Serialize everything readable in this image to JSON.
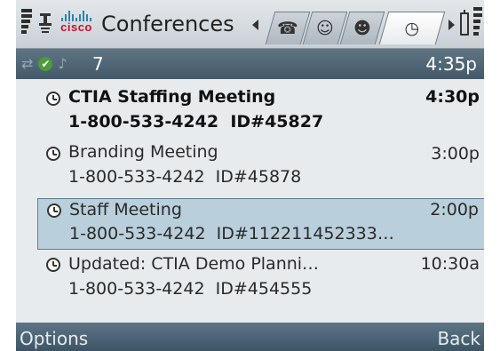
{
  "header": {
    "title": "Conferences",
    "logo_text": "cisco",
    "tabs": [
      {
        "icon": "phone-book-icon",
        "glyph": "☎"
      },
      {
        "icon": "meeting-icon",
        "glyph": "☺"
      },
      {
        "icon": "participants-icon",
        "glyph": "☻"
      },
      {
        "icon": "clock-icon",
        "glyph": "◷",
        "active": true
      }
    ]
  },
  "status": {
    "count": "7",
    "time": "4:35p"
  },
  "conferences": [
    {
      "title": "CTIA Staffing Meeting",
      "phone": "1-800-533-4242",
      "id": "ID#45827",
      "time": "4:30p"
    },
    {
      "title": "Branding Meeting",
      "phone": "1-800-533-4242",
      "id": "ID#45878",
      "time": "3:00p"
    },
    {
      "title": "Staff Meeting",
      "phone": "1-800-533-4242",
      "id": "ID#112211452333…",
      "time": "2:00p"
    },
    {
      "title": "Updated: CTIA Demo Planni…",
      "phone": "1-800-533-4242",
      "id": "ID#454555",
      "time": "10:30a"
    }
  ],
  "softkeys": {
    "left": "Options",
    "right": "Back"
  }
}
